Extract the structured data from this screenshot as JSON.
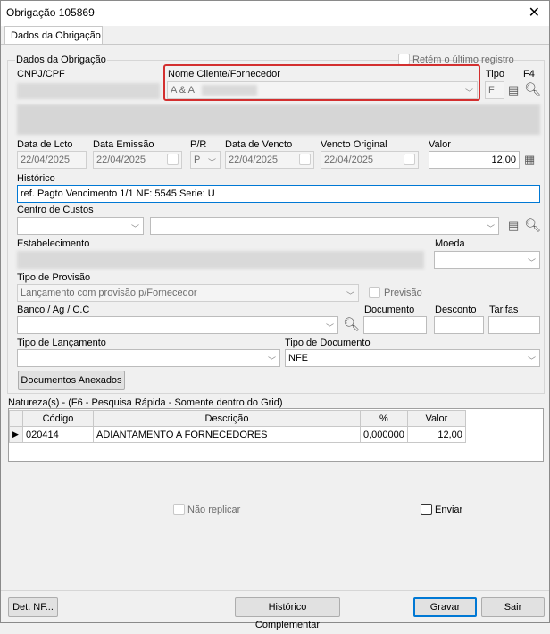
{
  "window": {
    "title": "Obrigação 105869",
    "close_label": "✕"
  },
  "tabs": [
    "Dados da Obrigação"
  ],
  "group_title": "Dados da Obrigação",
  "retem": {
    "label": "Retém o último registro"
  },
  "labels": {
    "cnpj": "CNPJ/CPF",
    "nome": "Nome Cliente/Fornecedor",
    "tipo": "Tipo",
    "f4": "F4",
    "data_lcto": "Data de Lcto",
    "data_emissao": "Data Emissão",
    "pr": "P/R",
    "data_vencto": "Data de Vencto",
    "vencto_original": "Vencto Original",
    "valor": "Valor",
    "historico": "Histórico",
    "centro_custos": "Centro de Custos",
    "estabelecimento": "Estabelecimento",
    "moeda": "Moeda",
    "tipo_provisao": "Tipo de Provisão",
    "previsao": "Previsão",
    "banco": "Banco / Ag / C.C",
    "documento": "Documento",
    "desconto": "Desconto",
    "tarifas": "Tarifas",
    "tipo_lancamento": "Tipo de Lançamento",
    "tipo_documento": "Tipo de Documento"
  },
  "values": {
    "nome": "A & A",
    "tipo": "F",
    "data_lcto": "22/04/2025",
    "data_emissao": "22/04/2025",
    "pr": "P",
    "data_vencto": "22/04/2025",
    "vencto_original": "22/04/2025",
    "valor": "12,00",
    "historico": "ref. Pagto Vencimento 1/1 NF: 5545 Serie: U",
    "tipo_provisao": "Lançamento com provisão p/Fornecedor",
    "tipo_documento": "NFE"
  },
  "buttons": {
    "documentos_anexados": "Documentos Anexados",
    "det_nf": "Det. NF...",
    "historico_complementar": "Histórico Complementar",
    "gravar": "Gravar",
    "sair": "Sair"
  },
  "natureza": {
    "title": "Natureza(s) - (F6 - Pesquisa Rápida - Somente dentro do Grid)",
    "columns": [
      "Código",
      "Descrição",
      "%",
      "Valor"
    ],
    "rows": [
      {
        "codigo": "020414",
        "descricao": "ADIANTAMENTO A FORNECEDORES",
        "pct": "0,000000",
        "valor": "12,00"
      }
    ]
  },
  "checkboxes": {
    "nao_replicar": "Não replicar",
    "enviar": "Enviar"
  }
}
